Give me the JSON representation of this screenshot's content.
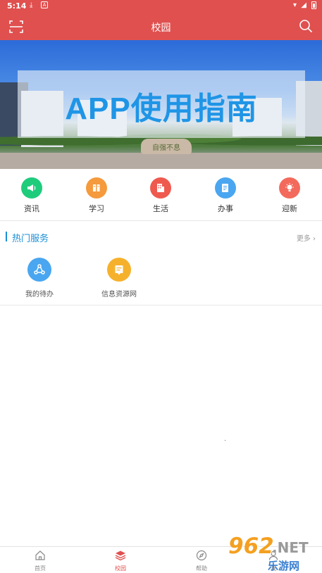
{
  "status_bar": {
    "time": "5:14"
  },
  "header": {
    "title": "校园",
    "bg_color": "#e0504f"
  },
  "banner": {
    "headline": "APP使用指南",
    "stone_inscription": "自强不息"
  },
  "categories": [
    {
      "label": "资讯",
      "icon": "megaphone-icon",
      "color": "#1fcc7c"
    },
    {
      "label": "学习",
      "icon": "books-icon",
      "color": "#f59a3d"
    },
    {
      "label": "生活",
      "icon": "building-icon",
      "color": "#ef5a4f"
    },
    {
      "label": "办事",
      "icon": "document-icon",
      "color": "#4aa6f0"
    },
    {
      "label": "迎新",
      "icon": "lightbulb-icon",
      "color": "#f36a5c"
    }
  ],
  "hot_services": {
    "title": "热门服务",
    "more_label": "更多",
    "items": [
      {
        "label": "我的待办",
        "icon": "share-icon",
        "color": "#4aa6f0"
      },
      {
        "label": "信息资源网",
        "icon": "note-icon",
        "color": "#f6b12c"
      }
    ]
  },
  "bottom_nav": [
    {
      "label": "首页",
      "icon": "home-icon",
      "active": false
    },
    {
      "label": "校园",
      "icon": "layers-icon",
      "active": true
    },
    {
      "label": "帮助",
      "icon": "compass-icon",
      "active": false
    },
    {
      "label": "我",
      "icon": "user-icon",
      "active": false
    }
  ],
  "watermark": {
    "number": "962",
    "suffix": ".NET",
    "chinese": "乐游网"
  }
}
